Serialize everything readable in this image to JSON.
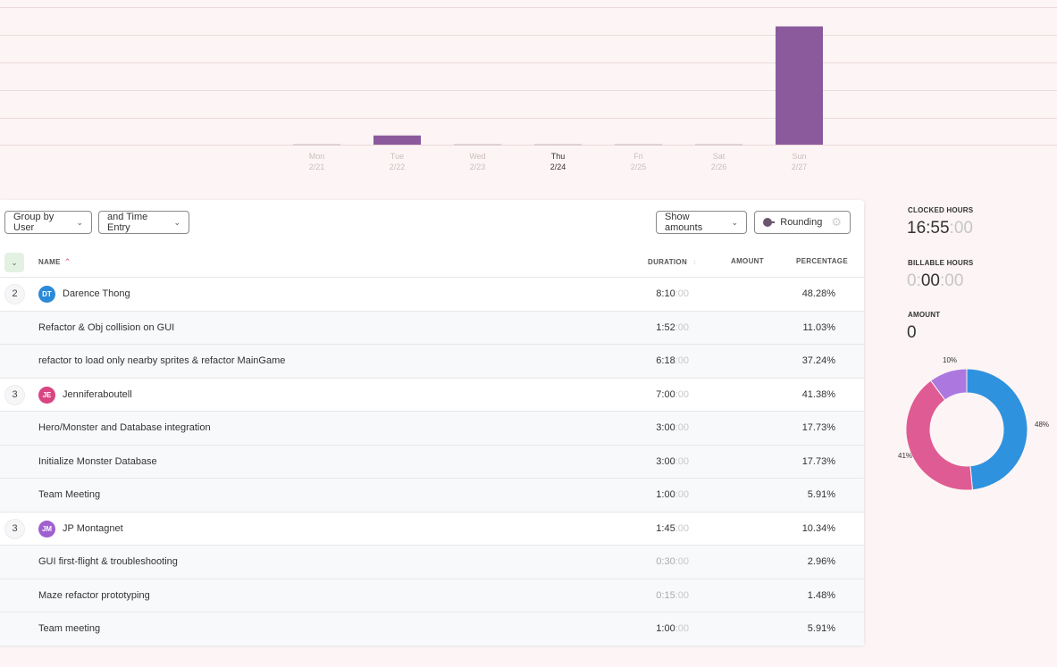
{
  "chart_data": {
    "type": "bar",
    "categories": [
      "Mon",
      "Tue",
      "Wed",
      "Thu",
      "Fri",
      "Sat",
      "Sun"
    ],
    "dates": [
      "2/21",
      "2/22",
      "2/23",
      "2/24",
      "2/25",
      "2/26",
      "2/27"
    ],
    "values": [
      0,
      1.0,
      0,
      0,
      0,
      0,
      12.9
    ],
    "highlighted": "Thu",
    "bar_color": "#8a5a9c",
    "ylim": [
      0,
      15
    ],
    "grid": true
  },
  "toolbar": {
    "group_by": "Group by User",
    "time_entry": "and Time Entry",
    "show_amounts": "Show amounts",
    "rounding": "Rounding"
  },
  "table": {
    "headers": {
      "name": "NAME",
      "duration": "DURATION",
      "amount": "AMOUNT",
      "percentage": "PERCENTAGE"
    },
    "rows": [
      {
        "kind": "user",
        "count": "2",
        "initials": "DT",
        "avatar_color": "#2b8ad8",
        "name": "Darence Thong",
        "dur_main": "8:10",
        "dur_dim": "",
        "dur_faint": ":00",
        "pct": "48.28%"
      },
      {
        "kind": "entry",
        "name": "Refactor & Obj collision on GUI",
        "dur_main": "1:52",
        "dur_dim": "",
        "dur_faint": ":00",
        "pct": "11.03%"
      },
      {
        "kind": "entry",
        "name": "refactor to load only nearby sprites & refactor MainGame",
        "dur_main": "6:18",
        "dur_dim": "",
        "dur_faint": ":00",
        "pct": "37.24%"
      },
      {
        "kind": "user",
        "count": "3",
        "initials": "JE",
        "avatar_color": "#d94582",
        "name": "Jenniferaboutell",
        "dur_main": "7:00",
        "dur_dim": "",
        "dur_faint": ":00",
        "pct": "41.38%"
      },
      {
        "kind": "entry",
        "name": "Hero/Monster and Database integration",
        "dur_main": "3:00",
        "dur_dim": "",
        "dur_faint": ":00",
        "pct": "17.73%"
      },
      {
        "kind": "entry",
        "name": "Initialize Monster Database",
        "dur_main": "3:00",
        "dur_dim": "",
        "dur_faint": ":00",
        "pct": "17.73%"
      },
      {
        "kind": "entry",
        "name": "Team Meeting",
        "dur_main": "1:00",
        "dur_dim": "",
        "dur_faint": ":00",
        "pct": "5.91%"
      },
      {
        "kind": "user",
        "count": "3",
        "initials": "JM",
        "avatar_color": "#a060d0",
        "name": "JP Montagnet",
        "dur_main": "1:45",
        "dur_dim": "",
        "dur_faint": ":00",
        "pct": "10.34%"
      },
      {
        "kind": "entry",
        "name": "GUI first-flight & troubleshooting",
        "dur_main": "",
        "dur_dim": "0:30",
        "dur_faint": ":00",
        "pct": "2.96%"
      },
      {
        "kind": "entry",
        "name": "Maze refactor prototyping",
        "dur_main": "",
        "dur_dim": "0:15",
        "dur_faint": ":00",
        "pct": "1.48%"
      },
      {
        "kind": "entry",
        "name": "Team meeting",
        "dur_main": "1:00",
        "dur_dim": "",
        "dur_faint": ":00",
        "pct": "5.91%"
      }
    ]
  },
  "stats": {
    "clocked_label": "CLOCKED HOURS",
    "clocked_main": "16:55",
    "clocked_faint": ":00",
    "billable_label": "BILLABLE HOURS",
    "billable_faint1": "0:",
    "billable_main": "00",
    "billable_faint2": ":00",
    "amount_label": "AMOUNT",
    "amount_value": "0"
  },
  "donut": {
    "slices": [
      {
        "name": "Darence Thong",
        "value": 48,
        "label": "48%",
        "color": "#2f92de"
      },
      {
        "name": "Jenniferaboutell",
        "value": 41,
        "label": "41%",
        "color": "#df5b93"
      },
      {
        "name": "JP Montagnet",
        "value": 10,
        "label": "10%",
        "color": "#ac78e0"
      }
    ]
  },
  "icons": {
    "chevron": "chevron-down-icon",
    "sort": "sort-up-icon",
    "gear": "gear-icon"
  }
}
